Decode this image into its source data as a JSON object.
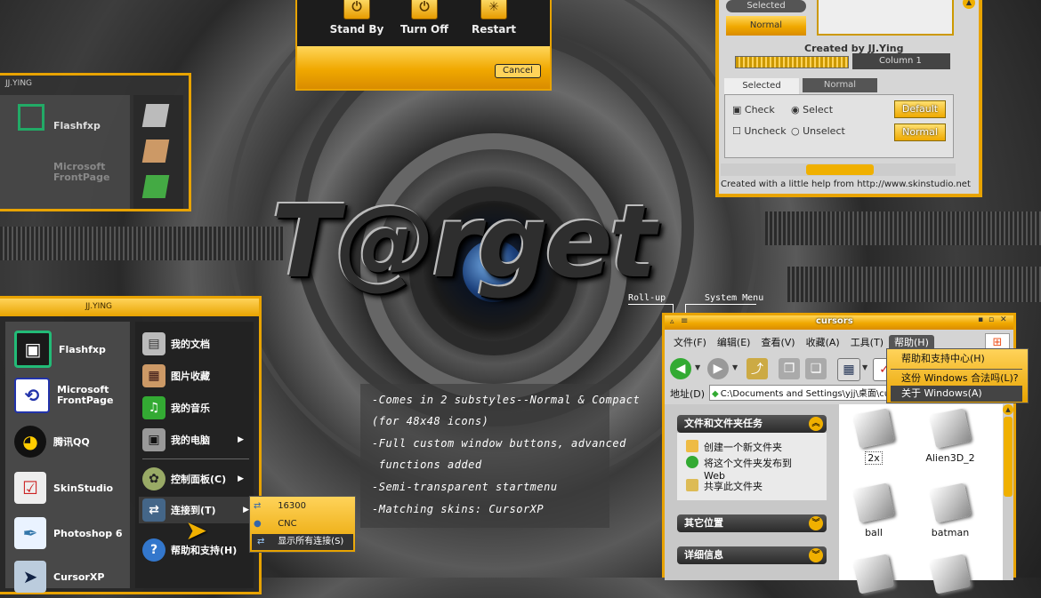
{
  "shutdown": {
    "standby": "Stand By",
    "turnoff": "Turn Off",
    "restart": "Restart",
    "cancel": "Cancel"
  },
  "skinstudio": {
    "selected": "Selected",
    "normal": "Normal",
    "created_by": "Created by JJ.Ying",
    "column": "Column 1",
    "tab_selected": "Selected",
    "tab_normal": "Normal",
    "check": "Check",
    "uncheck": "Uncheck",
    "select": "Select",
    "unselect": "Unselect",
    "default_btn": "Default",
    "normal_btn": "Normal",
    "status": "Created with a little help from http://www.skinstudio.net"
  },
  "compact_menu": {
    "user": "JJ.YING",
    "items": [
      {
        "label": "Flashfxp"
      },
      {
        "label": "Microsoft"
      },
      {
        "label": "FrontPage"
      }
    ]
  },
  "start_menu": {
    "user": "JJ.YING",
    "left": [
      {
        "label": "Flashfxp",
        "icon": "flashfxp-icon"
      },
      {
        "label": "Microsoft FrontPage",
        "icon": "frontpage-icon"
      },
      {
        "label": "腾讯QQ",
        "icon": "qq-icon"
      },
      {
        "label": "SkinStudio",
        "icon": "skinstudio-icon"
      },
      {
        "label": "Photoshop 6",
        "icon": "photoshop-icon"
      },
      {
        "label": "CursorXP",
        "icon": "cursorxp-icon"
      }
    ],
    "right": [
      {
        "label": "我的文档"
      },
      {
        "label": "图片收藏"
      },
      {
        "label": "我的音乐"
      },
      {
        "label": "我的电脑"
      },
      {
        "label": "控制面板(C)"
      },
      {
        "label": "连接到(T)"
      },
      {
        "label": "帮助和支持(H)"
      }
    ],
    "submenu": [
      {
        "label": "16300"
      },
      {
        "label": "CNC"
      },
      {
        "label": "显示所有连接(S)"
      }
    ]
  },
  "features": [
    "-Comes in 2 substyles--Normal & Compact",
    "(for 48x48 icons)",
    "-Full custom window buttons, advanced",
    " functions added",
    "-Semi-transparent startmenu",
    "-Matching skins: CursorXP"
  ],
  "callouts": {
    "rollup": "Roll-up",
    "sysmenu": "System Menu"
  },
  "explorer": {
    "title": "cursors",
    "menu": [
      "文件(F)",
      "编辑(E)",
      "查看(V)",
      "收藏(A)",
      "工具(T)",
      "帮助(H)"
    ],
    "address_label": "地址(D)",
    "address": "C:\\Documents and Settings\\yjj\\桌面\\cursors",
    "help_menu": [
      "帮助和支持中心(H)",
      "这份 Windows 合法吗(L)?",
      "关于 Windows(A)"
    ],
    "tasks_title": "文件和文件夹任务",
    "tasks": [
      "创建一个新文件夹",
      "将这个文件夹发布到 Web",
      "共享此文件夹"
    ],
    "other_places": "其它位置",
    "details": "详细信息",
    "files": [
      "2x",
      "Alien3D_2",
      "ball",
      "batman"
    ]
  },
  "logo": "T@rget"
}
